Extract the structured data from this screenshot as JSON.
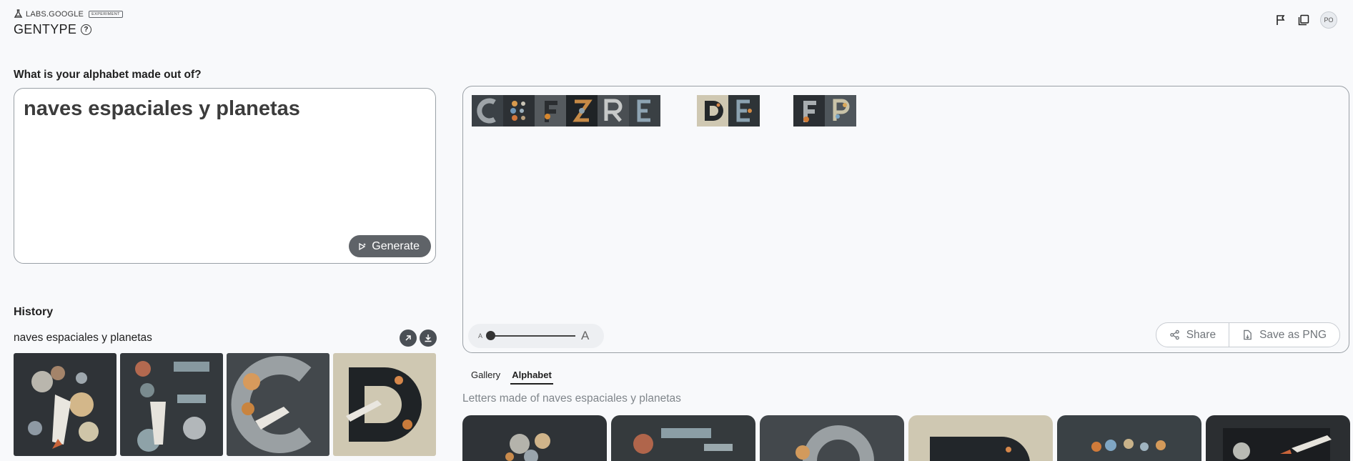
{
  "header": {
    "labs": "LABS.GOOGLE",
    "badge": "EXPERIMENT",
    "brand": "GENTYPE",
    "help_glyph": "?",
    "icons": [
      "flag-icon",
      "gallery-icon",
      "avatar"
    ],
    "avatar_text": "PO"
  },
  "prompt": {
    "question": "What is your alphabet made out of?",
    "value": "naves espaciales y planetas",
    "generate_label": "Generate"
  },
  "history": {
    "title": "History",
    "item_label": "naves espaciales y planetas",
    "thumbs": [
      "A",
      "B",
      "C",
      "D"
    ]
  },
  "preview": {
    "words": [
      [
        "C",
        "E",
        "F",
        "Z",
        "R",
        "E"
      ],
      [
        "D",
        "E"
      ],
      [
        "F",
        "P"
      ]
    ],
    "size_small": "A",
    "size_large": "A",
    "share_label": "Share",
    "save_label": "Save as PNG"
  },
  "tabs": [
    {
      "label": "Gallery",
      "active": false
    },
    {
      "label": "Alphabet",
      "active": true
    }
  ],
  "caption": "Letters made of naves espaciales y planetas",
  "gallery": [
    "A",
    "B",
    "C",
    "D",
    "E",
    "F"
  ],
  "colors": {
    "bg": "#f8f9fb",
    "button": "#5f6368",
    "tile_dark": "#2f3337",
    "tile_light": "#cfc8b2"
  }
}
